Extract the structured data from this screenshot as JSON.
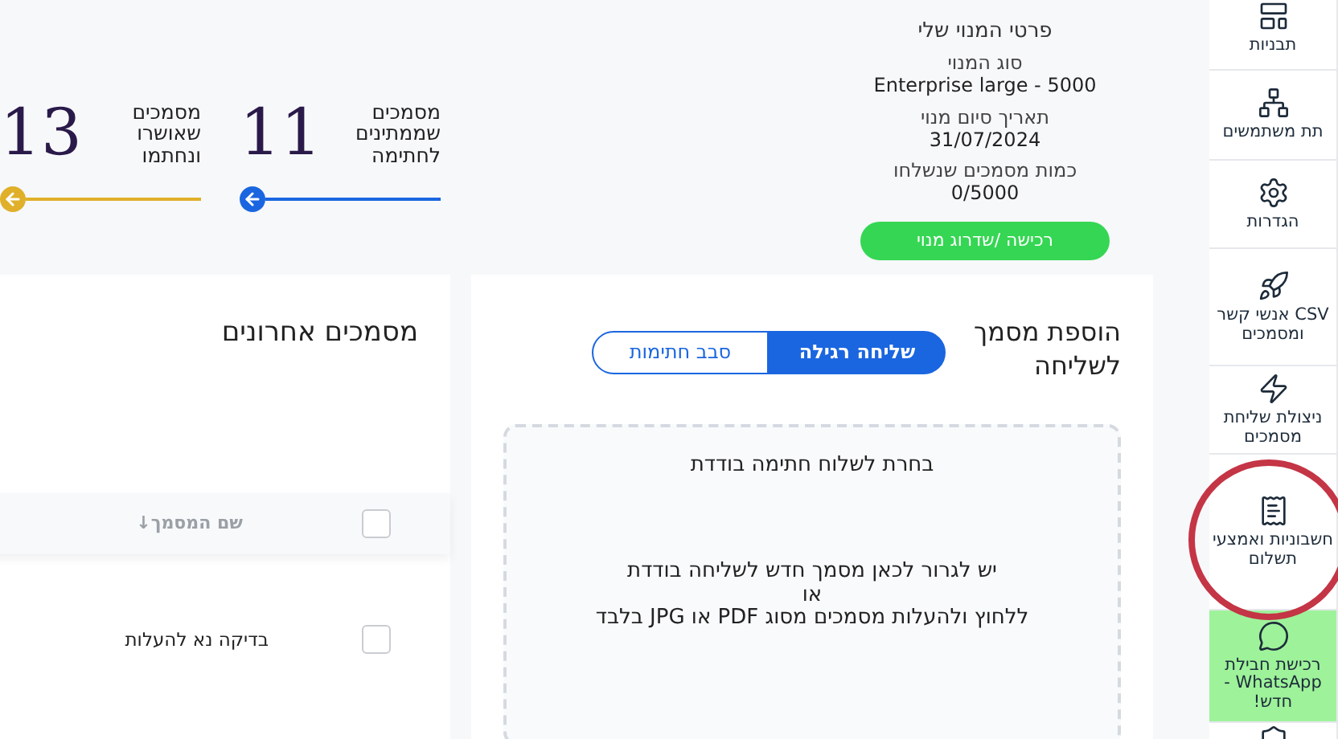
{
  "sidebar": {
    "items": [
      {
        "label": "תבניות",
        "kind": "link"
      },
      {
        "label": "תת משתמשים",
        "kind": "link"
      },
      {
        "label": "הגדרות",
        "kind": "link"
      },
      {
        "label": "CSV אנשי קשר ומסמכים",
        "kind": "link"
      },
      {
        "label": "ניצולת שליחת מסמכים",
        "kind": "link"
      },
      {
        "label": "חשבוניות ואמצעי תשלום",
        "kind": "link"
      },
      {
        "label": "רכישת חבילת WhatsApp - חדש!",
        "kind": "promo"
      },
      {
        "kind": "link"
      }
    ]
  },
  "stats": [
    {
      "number": "11",
      "label": "מסמכים שממתינים לחתימה",
      "color": "#1a66e0"
    },
    {
      "number": "13",
      "label": "מסמכים שאושרו ונחתמו",
      "color": "#e0b02a"
    }
  ],
  "plan": {
    "title": "פרטי המנוי שלי",
    "fields": [
      {
        "label": "סוג המנוי",
        "value": "Enterprise large - 5000"
      },
      {
        "label": "תאריך סיום מנוי",
        "value": "31/07/2024"
      },
      {
        "label": "כמות מסמכים שנשלחו",
        "value": "0/5000"
      }
    ],
    "button": "רכישה /שדרוג מנוי"
  },
  "add_document": {
    "title": "הוספת מסמך לשליחה",
    "tabs": [
      {
        "label": "שליחה רגילה",
        "selected": true
      },
      {
        "label": "סבב חתימות",
        "selected": false
      }
    ],
    "dropzone": {
      "heading": "בחרת לשלוח חתימה בודדת",
      "lines": [
        "יש לגרור לכאן מסמך חדש לשליחה בודדת",
        "או",
        "ללחוץ ולהעלות מסמכים מסוג PDF או JPG בלבד"
      ]
    }
  },
  "recent": {
    "title": "מסמכים אחרונים",
    "column": "שם המסמך",
    "sort_icon": "↓",
    "all_checked": false,
    "rows": [
      {
        "name": "בדיקה נא להעלות",
        "checked": false
      }
    ]
  }
}
